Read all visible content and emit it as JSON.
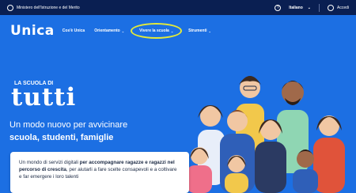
{
  "topbar": {
    "ministry": "Ministero dell'Istruzione e del Merito",
    "language": "Italiano",
    "login": "Accedi"
  },
  "nav": {
    "logo": "Unica",
    "items": [
      {
        "label": "Cos'è Unica"
      },
      {
        "label": "Orientamento"
      },
      {
        "label": "Vivere la scuola"
      },
      {
        "label": "Strumenti"
      }
    ]
  },
  "hero": {
    "eyebrow": "LA SCUOLA DI",
    "headline": "tutti",
    "subtitle_line1": "Un modo nuovo per avvicinare",
    "subtitle_line2": "scuola, studenti, famiglie"
  },
  "card": {
    "part1": "Un mondo di servizi digitali ",
    "part2_bold": "per accompagnare ragazze e ragazzi nel percorso di crescita",
    "part3": ", per aiutarli a fare scelte consapevoli e a coltivare e far emergere i loro talenti"
  },
  "colors": {
    "topbar": "#0a1f52",
    "hero": "#1c6fe3",
    "highlight": "#e3e93a"
  }
}
